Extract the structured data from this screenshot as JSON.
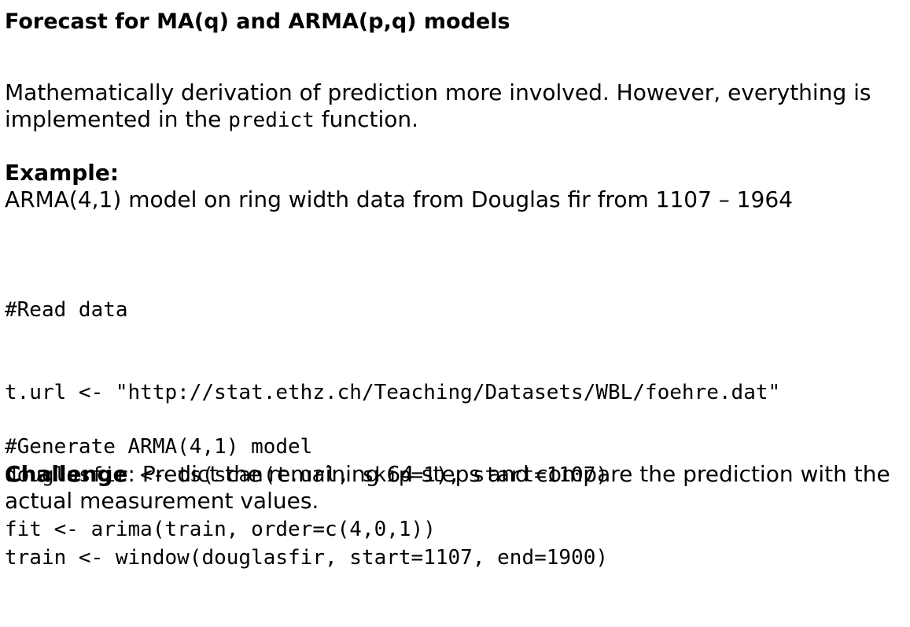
{
  "slide": {
    "title": "Forecast for MA(q) and ARMA(p,q) models",
    "intro": {
      "text_before": "Mathematically derivation of prediction more involved. However, everything is implemented in the ",
      "code_word": "predict",
      "text_after": " function."
    },
    "example": {
      "heading": "Example:",
      "description": "ARMA(4,1) model on ring width data from Douglas fir from 1107 – 1964"
    },
    "code_block_1": [
      "#Read data",
      "t.url <- \"http://stat.ethz.ch/Teaching/Datasets/WBL/foehre.dat\"",
      "douglasfir <- ts(scan(t.url, skip=1), start=1107)",
      "train <- window(douglasfir, start=1107, end=1900)"
    ],
    "code_block_2": [
      "#Generate ARMA(4,1) model",
      "fit <- arima(train, order=c(4,0,1))"
    ],
    "challenge": {
      "label": "Challenge",
      "text": ": Predict the remaining 64 steps and compare the prediction with the actual measurement values."
    }
  }
}
